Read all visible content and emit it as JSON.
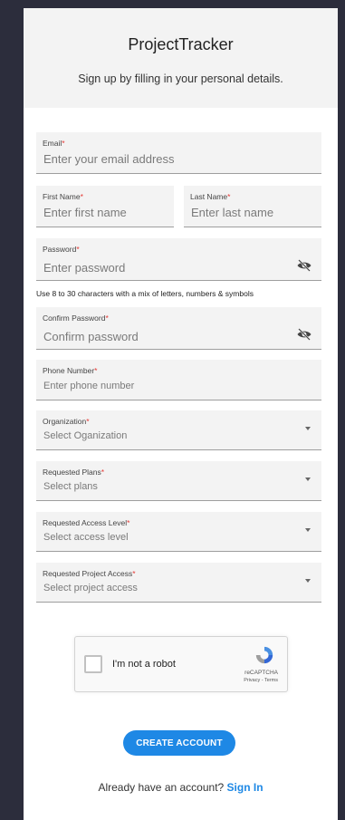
{
  "header": {
    "title": "ProjectTracker",
    "subtitle": "Sign up by filling in your personal details."
  },
  "fields": {
    "email": {
      "label": "Email",
      "placeholder": "Enter your email address"
    },
    "first_name": {
      "label": "First Name",
      "placeholder": "Enter first name"
    },
    "last_name": {
      "label": "Last Name",
      "placeholder": "Enter last name"
    },
    "password": {
      "label": "Password",
      "placeholder": "Enter password",
      "helper": "Use 8 to 30 characters with a mix of letters, numbers & symbols"
    },
    "confirm_password": {
      "label": "Confirm Password",
      "placeholder": "Confirm password"
    },
    "phone": {
      "label": "Phone Number",
      "placeholder": "Enter phone number"
    },
    "organization": {
      "label": "Organization",
      "placeholder": "Select Oganization"
    },
    "plans": {
      "label": "Requested Plans",
      "placeholder": "Select plans"
    },
    "access_level": {
      "label": "Requested Access Level",
      "placeholder": "Select access level"
    },
    "project_access": {
      "label": "Requested Project Access",
      "placeholder": "Select project access"
    }
  },
  "required_marker": "*",
  "captcha": {
    "label": "I'm not a robot",
    "brand": "reCAPTCHA",
    "links": "Privacy - Terms"
  },
  "actions": {
    "create_account": "CREATE ACCOUNT"
  },
  "footer": {
    "prompt": "Already have an account?",
    "signin": "Sign In"
  },
  "colors": {
    "accent": "#1e88e5",
    "required": "#e53935",
    "background": "#2c2d3c"
  }
}
